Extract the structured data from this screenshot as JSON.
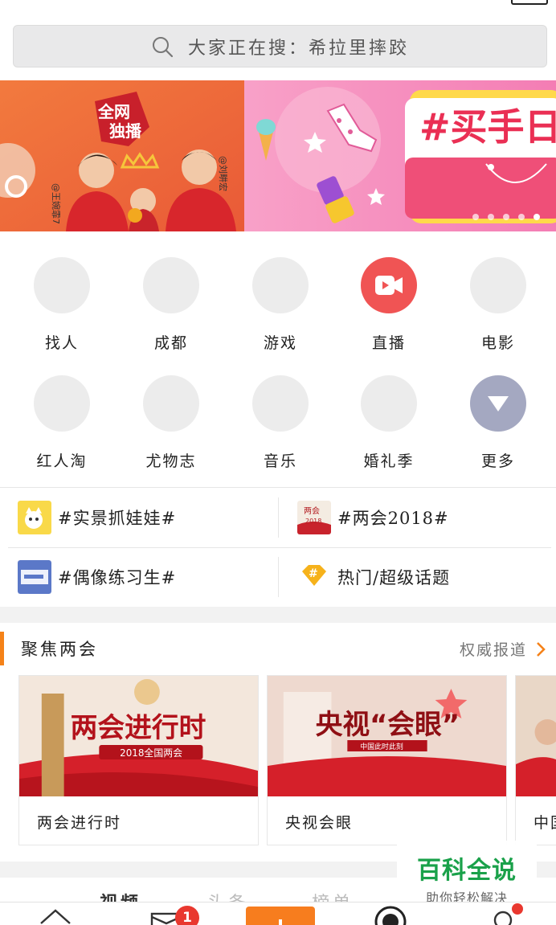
{
  "search": {
    "placeholder": "大家正在搜：希拉里摔跤"
  },
  "banner": {
    "slides": [
      {
        "badge": "全网独播",
        "badge_line1": "全网",
        "badge_line2": "独播",
        "tag_left": "@王婉霏7",
        "tag_right": "@刘畊宏"
      },
      {
        "headline": "#买手日"
      }
    ],
    "dot_count": 5
  },
  "grid": [
    {
      "label": "找人",
      "icon": "placeholder-circle"
    },
    {
      "label": "成都",
      "icon": "placeholder-circle"
    },
    {
      "label": "游戏",
      "icon": "placeholder-circle"
    },
    {
      "label": "直播",
      "icon": "live-video-icon",
      "color": "#f05454"
    },
    {
      "label": "电影",
      "icon": "placeholder-circle"
    },
    {
      "label": "红人淘",
      "icon": "placeholder-circle"
    },
    {
      "label": "尤物志",
      "icon": "placeholder-circle"
    },
    {
      "label": "音乐",
      "icon": "placeholder-circle"
    },
    {
      "label": "婚礼季",
      "icon": "placeholder-circle"
    },
    {
      "label": "更多",
      "icon": "more-triangle-icon",
      "color": "#a4a8c1"
    }
  ],
  "topics": [
    {
      "text": "#实景抓娃娃#",
      "icon": "cartoon-cat-icon"
    },
    {
      "text": "#两会2018#",
      "icon": "lianghui-2018-icon",
      "icon_text_1": "两会",
      "icon_text_2": "2018"
    },
    {
      "text": "#偶像练习生#",
      "icon": "idol-trainee-icon"
    },
    {
      "text": "热门/超级话题",
      "icon": "hashtag-diamond-icon"
    }
  ],
  "focus": {
    "title": "聚焦两会",
    "more_label": "权威报道",
    "cards": [
      {
        "caption": "两会进行时",
        "thumb_title": "两会进行时",
        "thumb_sub": "2018全国两会"
      },
      {
        "caption": "央视会眼",
        "thumb_title": "央视“会眼”",
        "thumb_sub": "中国此时此刻"
      },
      {
        "caption": "中国"
      }
    ]
  },
  "tabs": [
    {
      "label": "视频",
      "active": true
    },
    {
      "label": "头条",
      "active": false
    },
    {
      "label": "榜单",
      "active": false
    }
  ],
  "watermark": {
    "line1": "百科全说",
    "line2": "助你轻松解决"
  },
  "bottom_nav": {
    "messages_badge": "1",
    "accent": "#f77d1e"
  },
  "colors": {
    "accent": "#f58219",
    "live": "#f05454",
    "badge": "#e9382f",
    "brand_green": "#1aa14a"
  }
}
